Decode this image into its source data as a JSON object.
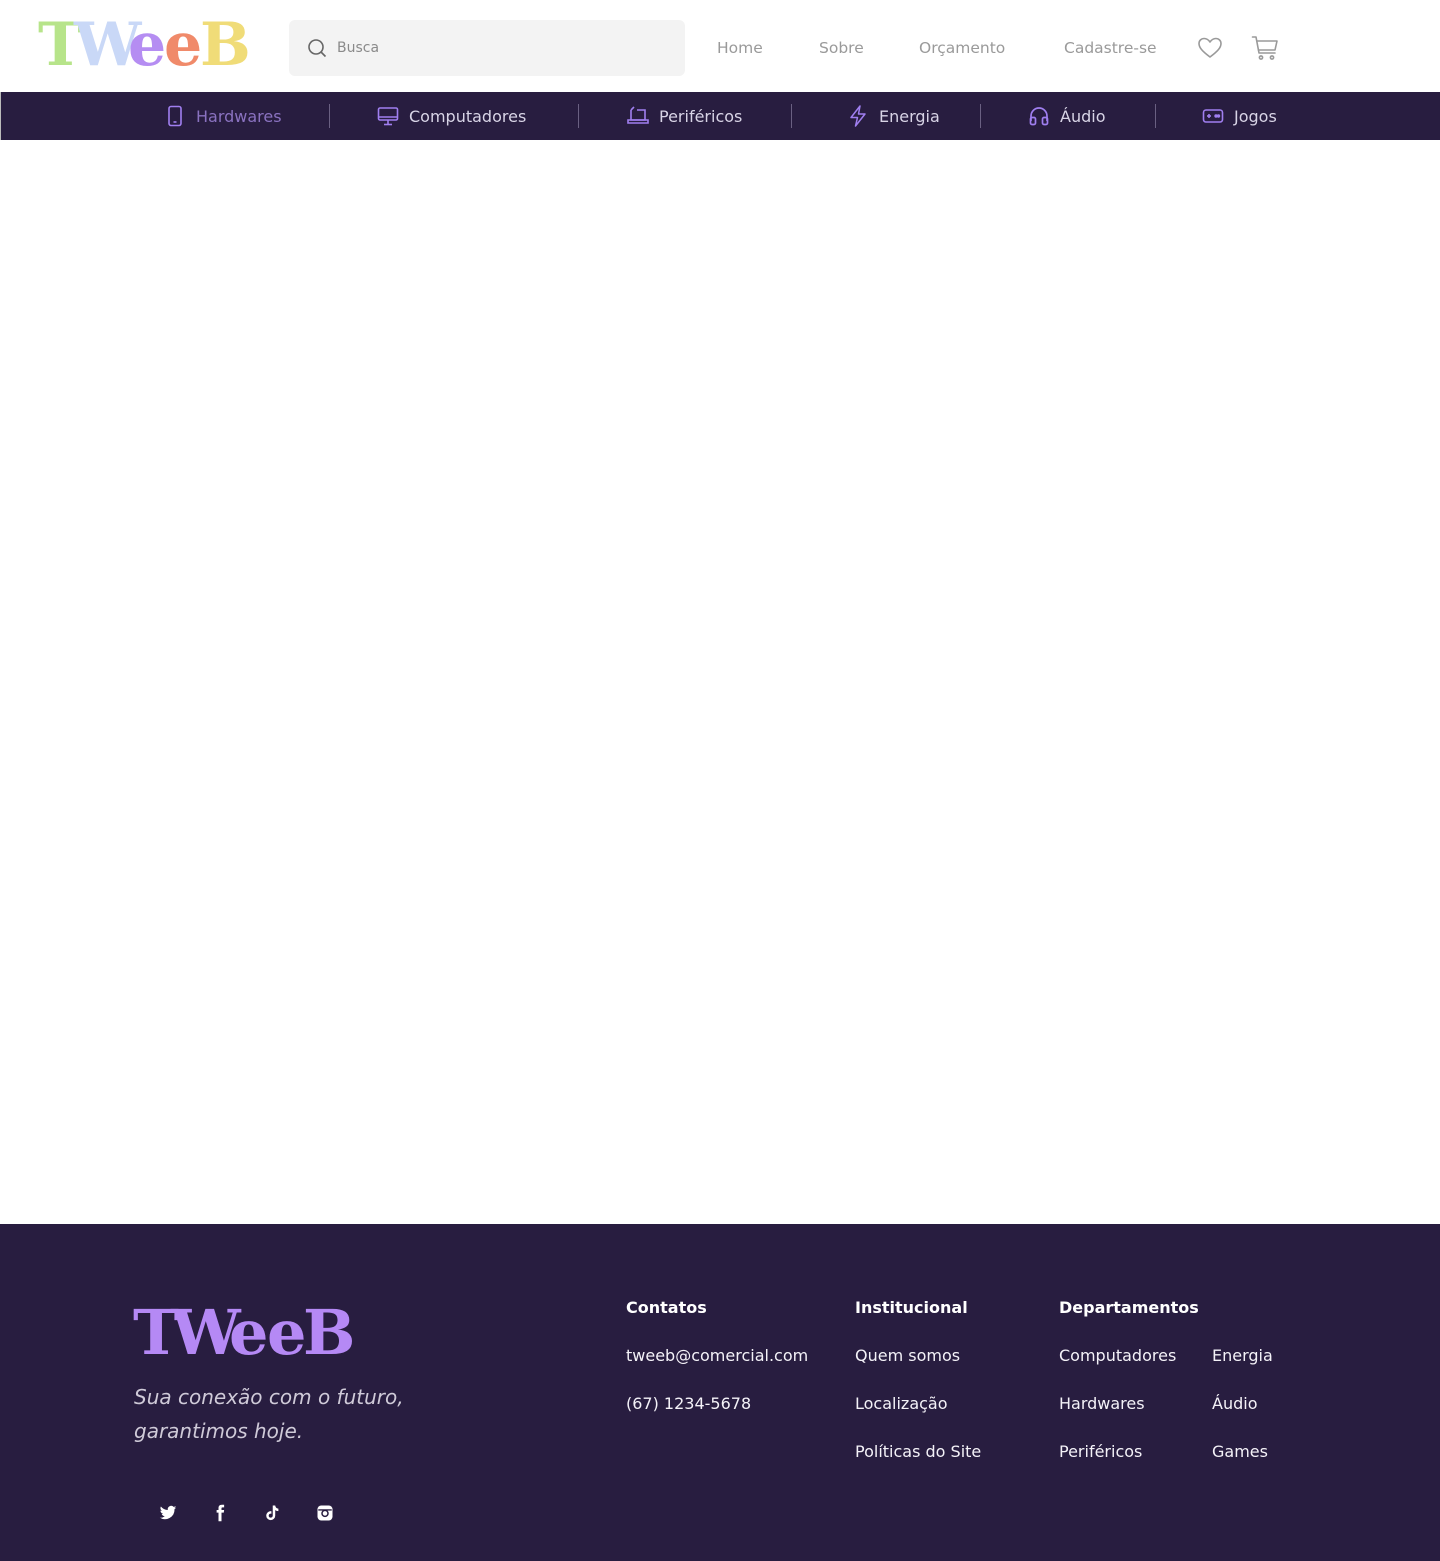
{
  "brand": {
    "logo_text": "TWeeB",
    "logo_letters": [
      {
        "ch": "T",
        "color": "#b7e48a"
      },
      {
        "ch": "W",
        "color": "#c9d8f7"
      },
      {
        "ch": "e",
        "color": "#b58df2"
      },
      {
        "ch": "e",
        "color": "#f08a6a"
      },
      {
        "ch": "B",
        "color": "#f0dc78"
      }
    ]
  },
  "header": {
    "search_placeholder": "Busca",
    "nav": [
      {
        "label": "Home"
      },
      {
        "label": "Sobre"
      },
      {
        "label": "Orçamento"
      },
      {
        "label": "Cadastre-se"
      }
    ],
    "icons": [
      "heart-icon",
      "cart-icon"
    ]
  },
  "categories": [
    {
      "label": "Hardwares",
      "icon": "phone-icon",
      "active": true
    },
    {
      "label": "Computadores",
      "icon": "monitor-icon",
      "active": false
    },
    {
      "label": "Periféricos",
      "icon": "laptop-icon",
      "active": false
    },
    {
      "label": "Energia",
      "icon": "lightning-icon",
      "active": false
    },
    {
      "label": "Áudio",
      "icon": "headphones-icon",
      "active": false
    },
    {
      "label": "Jogos",
      "icon": "gamepad-icon",
      "active": false
    }
  ],
  "footer": {
    "logo_text": "TWeeB",
    "tagline": "Sua conexão com o futuro, garantimos hoje.",
    "contatos": {
      "title": "Contatos",
      "items": [
        "tweeb@comercial.com",
        "(67) 1234-5678"
      ]
    },
    "institucional": {
      "title": "Institucional",
      "items": [
        "Quem somos",
        "Localização",
        "Políticas do Site"
      ]
    },
    "departamentos": {
      "title": "Departamentos",
      "col1": [
        "Computadores",
        "Hardwares",
        "Periféricos"
      ],
      "col2": [
        "Energia",
        "Áudio",
        "Games"
      ]
    },
    "social": [
      "twitter-icon",
      "facebook-icon",
      "tiktok-icon",
      "instagram-icon"
    ]
  },
  "colors": {
    "dark_purple": "#281d40",
    "accent_purple": "#b589f5",
    "active_category": "#8a72c0"
  }
}
